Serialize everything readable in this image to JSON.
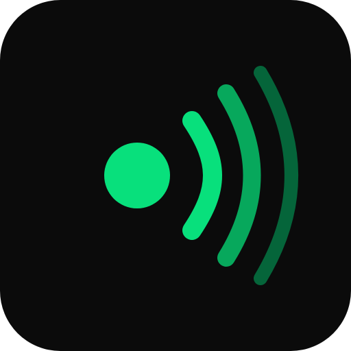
{
  "icon": {
    "name": "signal-broadcast-icon",
    "colors": {
      "background": "#0b0b0b",
      "dot": "#08e07c",
      "wave_inner": "#08e07c",
      "wave_middle": "#07a85c",
      "wave_outer": "#05653a"
    }
  }
}
